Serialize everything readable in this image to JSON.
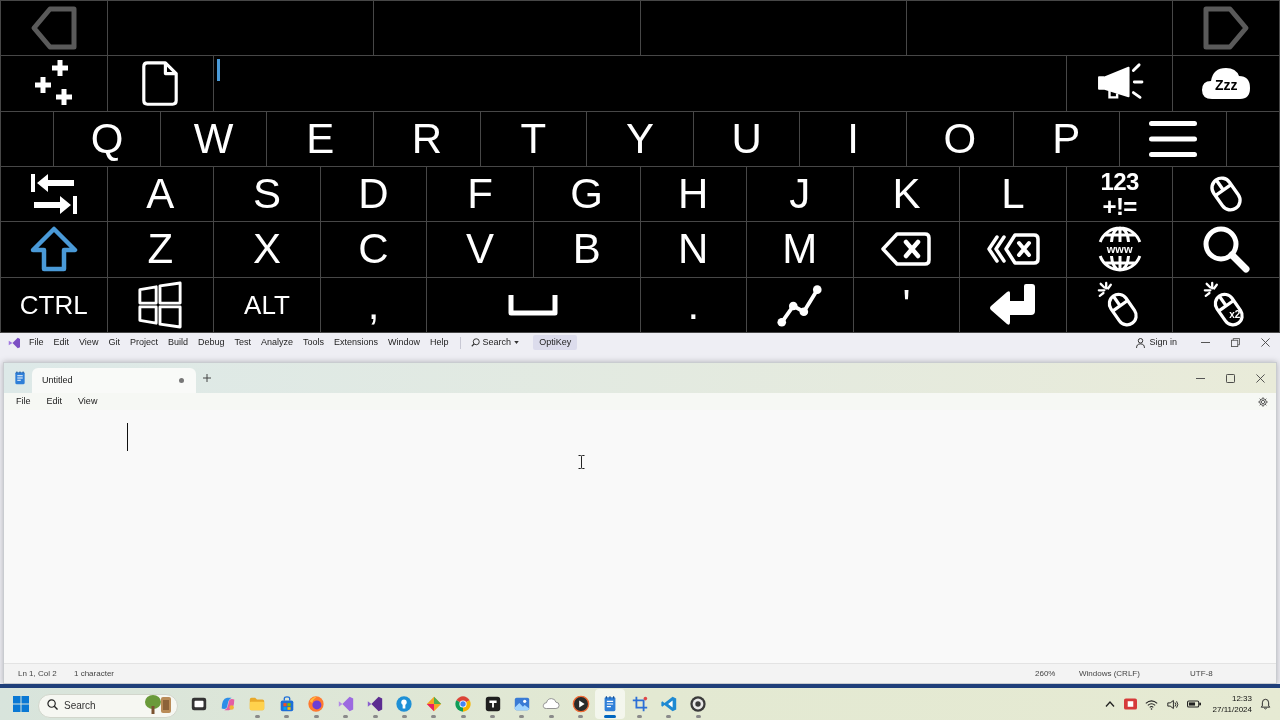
{
  "keyboard": {
    "rows": [
      [
        {
          "kind": "prev",
          "disabled": true
        },
        "",
        "",
        "",
        "",
        "",
        "",
        "",
        "",
        "",
        "",
        {
          "kind": "next",
          "disabled": true
        }
      ],
      [
        {
          "kind": "plus"
        },
        {
          "kind": "document"
        },
        {
          "kind": "output"
        },
        "",
        "",
        "",
        "",
        "",
        "",
        "",
        {
          "kind": "speak"
        },
        {
          "kind": "sleep",
          "label": "Zzz"
        }
      ],
      [
        {
          "kind": "letter",
          "label": "Q"
        },
        {
          "kind": "letter",
          "label": "W"
        },
        {
          "kind": "letter",
          "label": "E"
        },
        {
          "kind": "letter",
          "label": "R"
        },
        {
          "kind": "letter",
          "label": "T"
        },
        {
          "kind": "letter",
          "label": "Y"
        },
        {
          "kind": "letter",
          "label": "U"
        },
        {
          "kind": "letter",
          "label": "I"
        },
        {
          "kind": "letter",
          "label": "O"
        },
        {
          "kind": "letter",
          "label": "P"
        },
        {
          "kind": "menu"
        }
      ],
      [
        {
          "kind": "swap"
        },
        {
          "kind": "letter",
          "label": "A"
        },
        {
          "kind": "letter",
          "label": "S"
        },
        {
          "kind": "letter",
          "label": "D"
        },
        {
          "kind": "letter",
          "label": "F"
        },
        {
          "kind": "letter",
          "label": "G"
        },
        {
          "kind": "letter",
          "label": "H"
        },
        {
          "kind": "letter",
          "label": "J"
        },
        {
          "kind": "letter",
          "label": "K"
        },
        {
          "kind": "letter",
          "label": "L"
        },
        {
          "kind": "numbers",
          "label": "123",
          "sublabel": "+!="
        },
        {
          "kind": "mouse"
        }
      ],
      [
        {
          "kind": "shift",
          "on": true
        },
        {
          "kind": "letter",
          "label": "Z"
        },
        {
          "kind": "letter",
          "label": "X"
        },
        {
          "kind": "letter",
          "label": "C"
        },
        {
          "kind": "letter",
          "label": "V"
        },
        {
          "kind": "letter",
          "label": "B"
        },
        {
          "kind": "letter",
          "label": "N"
        },
        {
          "kind": "letter",
          "label": "M"
        },
        {
          "kind": "backspace"
        },
        {
          "kind": "backword"
        },
        {
          "kind": "web",
          "label": "www"
        },
        {
          "kind": "search"
        }
      ],
      [
        {
          "kind": "modifier",
          "label": "CTRL"
        },
        {
          "kind": "windows"
        },
        {
          "kind": "modifier",
          "label": "ALT"
        },
        {
          "kind": "letter",
          "label": ","
        },
        {
          "kind": "space"
        },
        "",
        {
          "kind": "letter",
          "label": "."
        },
        {
          "kind": "chart"
        },
        {
          "kind": "letter",
          "label": "'"
        },
        {
          "kind": "enter"
        },
        {
          "kind": "click"
        },
        {
          "kind": "dblclick",
          "label": "x2"
        }
      ]
    ]
  },
  "ide_window": {
    "menu": [
      "File",
      "Edit",
      "View",
      "Git",
      "Project",
      "Build",
      "Debug",
      "Test",
      "Analyze",
      "Tools",
      "Extensions",
      "Window",
      "Help"
    ],
    "search": "Search",
    "solution": "OptiKey",
    "sign_in": "Sign in"
  },
  "notepad": {
    "tabs": [
      {
        "title": "Untitled",
        "selected": true,
        "modified": true
      }
    ],
    "menu": [
      "File",
      "Edit",
      "View"
    ],
    "status_bar": {
      "position": "Ln 1, Col 2",
      "characters": "1 character",
      "zoom": "260%",
      "line_endings": "Windows (CRLF)",
      "encoding": "UTF-8"
    }
  },
  "taskbar": {
    "search": {
      "placeholder": "Search"
    },
    "apps": [
      {
        "kind": "stack",
        "running": false,
        "selected": false
      },
      {
        "kind": "swirl",
        "running": false,
        "selected": false
      },
      {
        "kind": "folder",
        "running": true,
        "selected": false
      },
      {
        "kind": "bag",
        "running": true,
        "selected": false
      },
      {
        "kind": "orb",
        "running": true,
        "selected": false
      },
      {
        "kind": "ribbonlight",
        "running": true,
        "selected": false
      },
      {
        "kind": "ribbon",
        "running": true,
        "selected": false
      },
      {
        "kind": "roundbadge",
        "running": true,
        "selected": false
      },
      {
        "kind": "kite",
        "running": true,
        "selected": false
      },
      {
        "kind": "segmented",
        "running": true,
        "selected": false
      },
      {
        "kind": "tile",
        "running": true,
        "selected": false
      },
      {
        "kind": "picture",
        "running": true,
        "selected": false
      },
      {
        "kind": "cloud",
        "running": true,
        "selected": false
      },
      {
        "kind": "play",
        "running": true,
        "selected": false
      },
      {
        "kind": "notepad",
        "running": true,
        "selected": true
      },
      {
        "kind": "crop",
        "running": true,
        "selected": false
      },
      {
        "kind": "coderibbon",
        "running": true,
        "selected": false
      },
      {
        "kind": "record",
        "running": true,
        "selected": false
      }
    ],
    "clock": {
      "time": "12:33",
      "date": "27/11/2024"
    }
  }
}
